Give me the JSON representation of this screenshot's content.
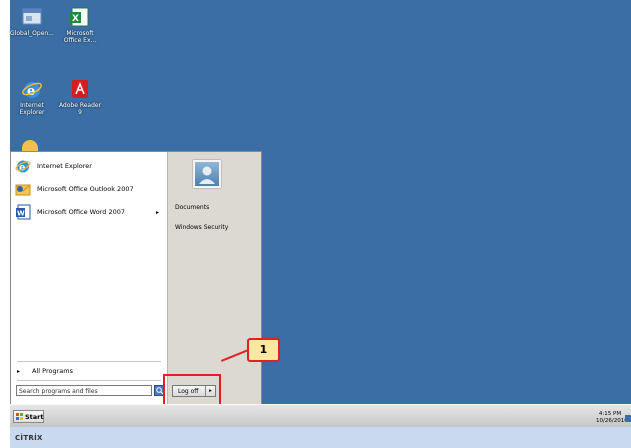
{
  "desktop_icons": [
    {
      "label": "Global_Open...",
      "icon": "window-app-icon"
    },
    {
      "label": "Microsoft Office Ex...",
      "icon": "excel-icon"
    },
    {
      "label": "Internet Explorer",
      "icon": "internet-explorer-icon"
    },
    {
      "label": "Adobe Reader 9",
      "icon": "adobe-reader-icon"
    }
  ],
  "start_menu": {
    "programs": [
      {
        "label": "Internet Explorer",
        "icon": "internet-explorer-icon"
      },
      {
        "label": "Microsoft Office Outlook 2007",
        "icon": "outlook-icon"
      },
      {
        "label": "Microsoft Office Word 2007",
        "icon": "word-icon",
        "submenu_arrow": "▸"
      }
    ],
    "all_programs": "All Programs",
    "search_placeholder": "Search programs and files",
    "right_links": [
      "Documents",
      "Windows Security"
    ],
    "logoff_label": "Log off",
    "logoff_arrow": "▸"
  },
  "callout": {
    "number": "1",
    "color": "#e32020"
  },
  "taskbar": {
    "start_label": "Start",
    "clock_time": "4:15 PM",
    "clock_date": "10/26/2010"
  },
  "citrix": {
    "logo_text": "CİTRİX"
  },
  "colors": {
    "desktop": "#3a6ea5",
    "highlight": "#e32020",
    "callout_bg": "#fbe6a2"
  }
}
